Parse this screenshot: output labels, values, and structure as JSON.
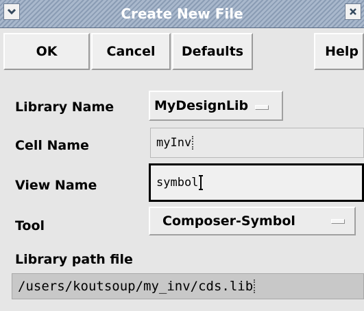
{
  "window": {
    "title": "Create New File",
    "menu_icon": "chevron-down-icon",
    "close_icon": "close-icon"
  },
  "buttons": {
    "ok": "OK",
    "cancel": "Cancel",
    "defaults": "Defaults",
    "help": "Help"
  },
  "form": {
    "library_name_label": "Library Name",
    "library_name_value": "MyDesignLib",
    "cell_name_label": "Cell Name",
    "cell_name_value": "myInv",
    "view_name_label": "View Name",
    "view_name_value": "symbol",
    "tool_label": "Tool",
    "tool_value": "Composer-Symbol",
    "library_path_label": "Library path file",
    "library_path_value": "/users/koutsoup/my_inv/cds.lib"
  },
  "colors": {
    "titlebar": "#a9b8cc",
    "background": "#e6e6e6",
    "active_field_border": "#000000",
    "readonly_field": "#c8c8c8"
  }
}
